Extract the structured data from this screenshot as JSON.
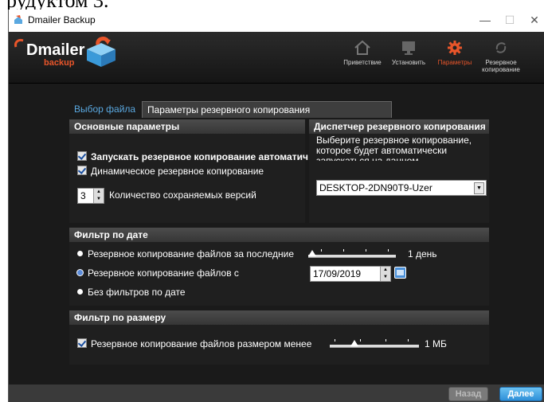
{
  "page_headline": "рудуктом 3.",
  "window": {
    "title": "Dmailer Backup",
    "controls": {
      "minimize": "—",
      "maximize": "☐",
      "close": "✕"
    }
  },
  "header": {
    "logo_text": "Dmailer",
    "logo_sub": "backup",
    "nav": [
      {
        "label": "Приветствие",
        "icon": "home-icon"
      },
      {
        "label": "Установить",
        "icon": "monitor-icon"
      },
      {
        "label": "Параметры",
        "icon": "gear-icon",
        "active": true
      },
      {
        "label": "Резервное копирование",
        "icon": "backup-icon"
      }
    ]
  },
  "tabs": [
    {
      "label": "Выбор файла",
      "active": false
    },
    {
      "label": "Параметры резервного копирования",
      "active": true
    }
  ],
  "basic": {
    "title": "Основные параметры",
    "auto_backup_label": "Запускать резервное копирование автоматич",
    "auto_backup_checked": true,
    "dynamic_backup_label": "Динамическое резервное копирование",
    "dynamic_backup_checked": true,
    "versions_value": "3",
    "versions_label": "Количество сохраняемых версий"
  },
  "dispatcher": {
    "title": "Диспетчер резервного копирования",
    "description": "Выберите резервное копирование, которое будет автоматически запускаться на данном",
    "selected": "DESKTOP-2DN90T9-Uzer"
  },
  "date_filter": {
    "title": "Фильтр по дате",
    "options": [
      {
        "label": "Резервное копирование файлов за последние",
        "selected": false
      },
      {
        "label": "Резервное копирование файлов с",
        "selected": true
      },
      {
        "label": "Без фильтров по дате",
        "selected": false
      }
    ],
    "last_value_label": "1 день",
    "last_value_fraction": 0.0,
    "since_date": "17/09/2019"
  },
  "size_filter": {
    "title": "Фильтр по размеру",
    "label": "Резервное копирование файлов размером менее",
    "checked": true,
    "value_label": "1 МБ",
    "value_fraction": 0.25
  },
  "footer": {
    "back_label": "Назад",
    "next_label": "Далее"
  },
  "colors": {
    "accent": "#e8552a",
    "link": "#5aa8e0",
    "next_button": "#2e8fd8"
  }
}
